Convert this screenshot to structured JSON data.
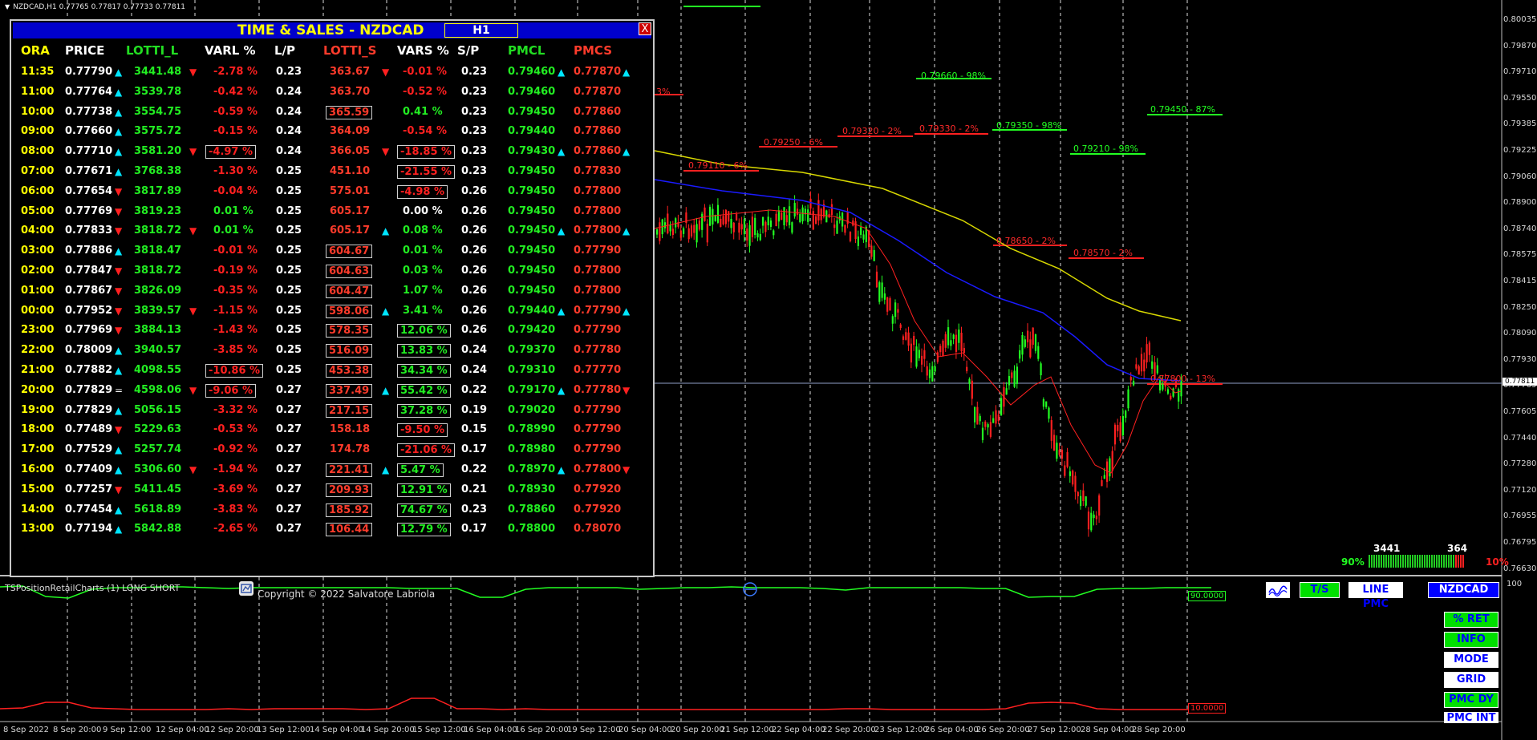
{
  "symbol_header": "NZDCAD,H1  0.77765 0.77817 0.77733 0.77811",
  "ts": {
    "title": "TIME & SALES  - NZDCAD",
    "timeframe": "H1",
    "close_label": "X",
    "headers": [
      "ORA",
      "PRICE",
      "LOTTI_L",
      "VARL %",
      "L/P",
      "LOTTI_S",
      "VARS %",
      "S/P",
      "PMCL",
      "PMCS"
    ],
    "header_colors": [
      "#ffff00",
      "#ffffff",
      "#22dd22",
      "#ffffff",
      "#ffffff",
      "#ff3b2b",
      "#ffffff",
      "#ffffff",
      "#22dd22",
      "#ff3b2b"
    ],
    "rows": [
      {
        "ora": "11:35",
        "price": "0.77790",
        "pdir": "up",
        "lotti_l": "3441.48",
        "ldir": "dn",
        "varl": "-2.78 %",
        "varl_c": "r",
        "varl_box": false,
        "lp": "0.23",
        "lotti_s": "363.67",
        "sdir": "dn",
        "s_box": false,
        "vars": "-0.01 %",
        "vars_c": "r",
        "vars_box": false,
        "sp": "0.23",
        "pmcl": "0.79460",
        "pldir": "up",
        "pmcs": "0.77870",
        "psdir": "up"
      },
      {
        "ora": "11:00",
        "price": "0.77764",
        "pdir": "up",
        "lotti_l": "3539.78",
        "ldir": "",
        "varl": "-0.42 %",
        "varl_c": "r",
        "varl_box": false,
        "lp": "0.24",
        "lotti_s": "363.70",
        "sdir": "",
        "s_box": false,
        "vars": "-0.52 %",
        "vars_c": "r",
        "vars_box": false,
        "sp": "0.23",
        "pmcl": "0.79460",
        "pldir": "",
        "pmcs": "0.77870",
        "psdir": ""
      },
      {
        "ora": "10:00",
        "price": "0.77738",
        "pdir": "up",
        "lotti_l": "3554.75",
        "ldir": "",
        "varl": "-0.59 %",
        "varl_c": "r",
        "varl_box": false,
        "lp": "0.24",
        "lotti_s": "365.59",
        "sdir": "",
        "s_box": true,
        "vars": "0.41 %",
        "vars_c": "g",
        "vars_box": false,
        "sp": "0.23",
        "pmcl": "0.79450",
        "pldir": "",
        "pmcs": "0.77860",
        "psdir": ""
      },
      {
        "ora": "09:00",
        "price": "0.77660",
        "pdir": "up",
        "lotti_l": "3575.72",
        "ldir": "",
        "varl": "-0.15 %",
        "varl_c": "r",
        "varl_box": false,
        "lp": "0.24",
        "lotti_s": "364.09",
        "sdir": "",
        "s_box": false,
        "vars": "-0.54 %",
        "vars_c": "r",
        "vars_box": false,
        "sp": "0.23",
        "pmcl": "0.79440",
        "pldir": "",
        "pmcs": "0.77860",
        "psdir": ""
      },
      {
        "ora": "08:00",
        "price": "0.77710",
        "pdir": "up",
        "lotti_l": "3581.20",
        "ldir": "dn",
        "varl": "-4.97 %",
        "varl_c": "r",
        "varl_box": true,
        "lp": "0.24",
        "lotti_s": "366.05",
        "sdir": "dn",
        "s_box": false,
        "vars": "-18.85 %",
        "vars_c": "r",
        "vars_box": true,
        "sp": "0.23",
        "pmcl": "0.79430",
        "pldir": "up",
        "pmcs": "0.77860",
        "psdir": "up"
      },
      {
        "ora": "07:00",
        "price": "0.77671",
        "pdir": "up",
        "lotti_l": "3768.38",
        "ldir": "",
        "varl": "-1.30 %",
        "varl_c": "r",
        "varl_box": false,
        "lp": "0.25",
        "lotti_s": "451.10",
        "sdir": "",
        "s_box": false,
        "vars": "-21.55 %",
        "vars_c": "r",
        "vars_box": true,
        "sp": "0.23",
        "pmcl": "0.79450",
        "pldir": "",
        "pmcs": "0.77830",
        "psdir": ""
      },
      {
        "ora": "06:00",
        "price": "0.77654",
        "pdir": "dn",
        "lotti_l": "3817.89",
        "ldir": "",
        "varl": "-0.04 %",
        "varl_c": "r",
        "varl_box": false,
        "lp": "0.25",
        "lotti_s": "575.01",
        "sdir": "",
        "s_box": false,
        "vars": "-4.98 %",
        "vars_c": "r",
        "vars_box": true,
        "sp": "0.26",
        "pmcl": "0.79450",
        "pldir": "",
        "pmcs": "0.77800",
        "psdir": ""
      },
      {
        "ora": "05:00",
        "price": "0.77769",
        "pdir": "dn",
        "lotti_l": "3819.23",
        "ldir": "",
        "varl": "0.01 %",
        "varl_c": "g",
        "varl_box": false,
        "lp": "0.25",
        "lotti_s": "605.17",
        "sdir": "",
        "s_box": false,
        "vars": "0.00 %",
        "vars_c": "w",
        "vars_box": false,
        "sp": "0.26",
        "pmcl": "0.79450",
        "pldir": "",
        "pmcs": "0.77800",
        "psdir": ""
      },
      {
        "ora": "04:00",
        "price": "0.77833",
        "pdir": "dn",
        "lotti_l": "3818.72",
        "ldir": "dn",
        "varl": "0.01 %",
        "varl_c": "g",
        "varl_box": false,
        "lp": "0.25",
        "lotti_s": "605.17",
        "sdir": "up",
        "s_box": false,
        "vars": "0.08 %",
        "vars_c": "g",
        "vars_box": false,
        "sp": "0.26",
        "pmcl": "0.79450",
        "pldir": "up",
        "pmcs": "0.77800",
        "psdir": "up"
      },
      {
        "ora": "03:00",
        "price": "0.77886",
        "pdir": "up",
        "lotti_l": "3818.47",
        "ldir": "",
        "varl": "-0.01 %",
        "varl_c": "r",
        "varl_box": false,
        "lp": "0.25",
        "lotti_s": "604.67",
        "sdir": "",
        "s_box": true,
        "vars": "0.01 %",
        "vars_c": "g",
        "vars_box": false,
        "sp": "0.26",
        "pmcl": "0.79450",
        "pldir": "",
        "pmcs": "0.77790",
        "psdir": ""
      },
      {
        "ora": "02:00",
        "price": "0.77847",
        "pdir": "dn",
        "lotti_l": "3818.72",
        "ldir": "",
        "varl": "-0.19 %",
        "varl_c": "r",
        "varl_box": false,
        "lp": "0.25",
        "lotti_s": "604.63",
        "sdir": "",
        "s_box": true,
        "vars": "0.03 %",
        "vars_c": "g",
        "vars_box": false,
        "sp": "0.26",
        "pmcl": "0.79450",
        "pldir": "",
        "pmcs": "0.77800",
        "psdir": ""
      },
      {
        "ora": "01:00",
        "price": "0.77867",
        "pdir": "dn",
        "lotti_l": "3826.09",
        "ldir": "",
        "varl": "-0.35 %",
        "varl_c": "r",
        "varl_box": false,
        "lp": "0.25",
        "lotti_s": "604.47",
        "sdir": "",
        "s_box": true,
        "vars": "1.07 %",
        "vars_c": "g",
        "vars_box": false,
        "sp": "0.26",
        "pmcl": "0.79450",
        "pldir": "",
        "pmcs": "0.77800",
        "psdir": ""
      },
      {
        "ora": "00:00",
        "price": "0.77952",
        "pdir": "dn",
        "lotti_l": "3839.57",
        "ldir": "dn",
        "varl": "-1.15 %",
        "varl_c": "r",
        "varl_box": false,
        "lp": "0.25",
        "lotti_s": "598.06",
        "sdir": "up",
        "s_box": true,
        "vars": "3.41 %",
        "vars_c": "g",
        "vars_box": false,
        "sp": "0.26",
        "pmcl": "0.79440",
        "pldir": "up",
        "pmcs": "0.77790",
        "psdir": "up"
      },
      {
        "ora": "23:00",
        "price": "0.77969",
        "pdir": "dn",
        "lotti_l": "3884.13",
        "ldir": "",
        "varl": "-1.43 %",
        "varl_c": "r",
        "varl_box": false,
        "lp": "0.25",
        "lotti_s": "578.35",
        "sdir": "",
        "s_box": true,
        "vars": "12.06 %",
        "vars_c": "g",
        "vars_box": true,
        "sp": "0.26",
        "pmcl": "0.79420",
        "pldir": "",
        "pmcs": "0.77790",
        "psdir": ""
      },
      {
        "ora": "22:00",
        "price": "0.78009",
        "pdir": "up",
        "lotti_l": "3940.57",
        "ldir": "",
        "varl": "-3.85 %",
        "varl_c": "r",
        "varl_box": false,
        "lp": "0.25",
        "lotti_s": "516.09",
        "sdir": "",
        "s_box": true,
        "vars": "13.83 %",
        "vars_c": "g",
        "vars_box": true,
        "sp": "0.24",
        "pmcl": "0.79370",
        "pldir": "",
        "pmcs": "0.77780",
        "psdir": ""
      },
      {
        "ora": "21:00",
        "price": "0.77882",
        "pdir": "up",
        "lotti_l": "4098.55",
        "ldir": "",
        "varl": "-10.86 %",
        "varl_c": "r",
        "varl_box": true,
        "lp": "0.25",
        "lotti_s": "453.38",
        "sdir": "",
        "s_box": true,
        "vars": "34.34 %",
        "vars_c": "g",
        "vars_box": true,
        "sp": "0.24",
        "pmcl": "0.79310",
        "pldir": "",
        "pmcs": "0.77770",
        "psdir": ""
      },
      {
        "ora": "20:00",
        "price": "0.77829",
        "pdir": "eq",
        "lotti_l": "4598.06",
        "ldir": "dn",
        "varl": "-9.06 %",
        "varl_c": "r",
        "varl_box": true,
        "lp": "0.27",
        "lotti_s": "337.49",
        "sdir": "up",
        "s_box": true,
        "vars": "55.42 %",
        "vars_c": "g",
        "vars_box": true,
        "sp": "0.22",
        "pmcl": "0.79170",
        "pldir": "up",
        "pmcs": "0.77780",
        "psdir": "dn"
      },
      {
        "ora": "19:00",
        "price": "0.77829",
        "pdir": "up",
        "lotti_l": "5056.15",
        "ldir": "",
        "varl": "-3.32 %",
        "varl_c": "r",
        "varl_box": false,
        "lp": "0.27",
        "lotti_s": "217.15",
        "sdir": "",
        "s_box": true,
        "vars": "37.28 %",
        "vars_c": "g",
        "vars_box": true,
        "sp": "0.19",
        "pmcl": "0.79020",
        "pldir": "",
        "pmcs": "0.77790",
        "psdir": ""
      },
      {
        "ora": "18:00",
        "price": "0.77489",
        "pdir": "dn",
        "lotti_l": "5229.63",
        "ldir": "",
        "varl": "-0.53 %",
        "varl_c": "r",
        "varl_box": false,
        "lp": "0.27",
        "lotti_s": "158.18",
        "sdir": "",
        "s_box": false,
        "vars": "-9.50 %",
        "vars_c": "r",
        "vars_box": true,
        "sp": "0.15",
        "pmcl": "0.78990",
        "pldir": "",
        "pmcs": "0.77790",
        "psdir": ""
      },
      {
        "ora": "17:00",
        "price": "0.77529",
        "pdir": "up",
        "lotti_l": "5257.74",
        "ldir": "",
        "varl": "-0.92 %",
        "varl_c": "r",
        "varl_box": false,
        "lp": "0.27",
        "lotti_s": "174.78",
        "sdir": "",
        "s_box": false,
        "vars": "-21.06 %",
        "vars_c": "r",
        "vars_box": true,
        "sp": "0.17",
        "pmcl": "0.78980",
        "pldir": "",
        "pmcs": "0.77790",
        "psdir": ""
      },
      {
        "ora": "16:00",
        "price": "0.77409",
        "pdir": "up",
        "lotti_l": "5306.60",
        "ldir": "dn",
        "varl": "-1.94 %",
        "varl_c": "r",
        "varl_box": false,
        "lp": "0.27",
        "lotti_s": "221.41",
        "sdir": "up",
        "s_box": true,
        "vars": "5.47 %",
        "vars_c": "g",
        "vars_box": true,
        "sp": "0.22",
        "pmcl": "0.78970",
        "pldir": "up",
        "pmcs": "0.77800",
        "psdir": "dn"
      },
      {
        "ora": "15:00",
        "price": "0.77257",
        "pdir": "dn",
        "lotti_l": "5411.45",
        "ldir": "",
        "varl": "-3.69 %",
        "varl_c": "r",
        "varl_box": false,
        "lp": "0.27",
        "lotti_s": "209.93",
        "sdir": "",
        "s_box": true,
        "vars": "12.91 %",
        "vars_c": "g",
        "vars_box": true,
        "sp": "0.21",
        "pmcl": "0.78930",
        "pldir": "",
        "pmcs": "0.77920",
        "psdir": ""
      },
      {
        "ora": "14:00",
        "price": "0.77454",
        "pdir": "up",
        "lotti_l": "5618.89",
        "ldir": "",
        "varl": "-3.83 %",
        "varl_c": "r",
        "varl_box": false,
        "lp": "0.27",
        "lotti_s": "185.92",
        "sdir": "",
        "s_box": true,
        "vars": "74.67 %",
        "vars_c": "g",
        "vars_box": true,
        "sp": "0.23",
        "pmcl": "0.78860",
        "pldir": "",
        "pmcs": "0.77920",
        "psdir": ""
      },
      {
        "ora": "13:00",
        "price": "0.77194",
        "pdir": "up",
        "lotti_l": "5842.88",
        "ldir": "",
        "varl": "-2.65 %",
        "varl_c": "r",
        "varl_box": false,
        "lp": "0.27",
        "lotti_s": "106.44",
        "sdir": "",
        "s_box": true,
        "vars": "12.79 %",
        "vars_c": "g",
        "vars_box": true,
        "sp": "0.17",
        "pmcl": "0.78800",
        "pldir": "",
        "pmcs": "0.78070",
        "psdir": ""
      }
    ]
  },
  "price_axis": [
    "0.80035",
    "0.79870",
    "0.79710",
    "0.79550",
    "0.79385",
    "0.79225",
    "0.79060",
    "0.78900",
    "0.78740",
    "0.78575",
    "0.78415",
    "0.78250",
    "0.78090",
    "0.77930",
    "0.77765",
    "0.77605",
    "0.77440",
    "0.77280",
    "0.77120",
    "0.76955",
    "0.76795",
    "0.76630"
  ],
  "current_price": "0.77811",
  "indicator_max": "100",
  "time_axis": [
    "8 Sep 2022",
    "8 Sep 20:00",
    "9 Sep 12:00",
    "12 Sep 04:00",
    "12 Sep 20:00",
    "13 Sep 12:00",
    "14 Sep 04:00",
    "14 Sep 20:00",
    "15 Sep 12:00",
    "16 Sep 04:00",
    "16 Sep 20:00",
    "19 Sep 12:00",
    "20 Sep 04:00",
    "20 Sep 20:00",
    "21 Sep 12:00",
    "22 Sep 04:00",
    "22 Sep 20:00",
    "23 Sep 12:00",
    "26 Sep 04:00",
    "26 Sep 20:00",
    "27 Sep 12:00",
    "28 Sep 04:00",
    "28 Sep 20:00"
  ],
  "levels": [
    {
      "text": "0.79660 - 98%",
      "color": "green"
    },
    {
      "text": "0.79450 - 87%",
      "color": "green"
    },
    {
      "text": "0.79350 - 98%",
      "color": "green"
    },
    {
      "text": "0.79210 - 98%",
      "color": "green"
    },
    {
      "text": "0.79250 - 6%",
      "color": "red"
    },
    {
      "text": "0.79320 - 2%",
      "color": "red"
    },
    {
      "text": "0.79330 - 2%",
      "color": "red"
    },
    {
      "text": "0.79110 - 6%",
      "color": "red"
    },
    {
      "text": "0.78650 - 2%",
      "color": "red"
    },
    {
      "text": "0.78570 - 2%",
      "color": "red"
    },
    {
      "text": "0.77800 - 13%",
      "color": "red"
    },
    {
      "text": "3%",
      "color": "red"
    }
  ],
  "indicator": {
    "name": "TSPositionRetailCharts (1) LONG SHORT",
    "copyright": "Copyright © 2022 Salvatore Labriola",
    "top_value": "90.0000",
    "bottom_value": "10.0000"
  },
  "longshort": {
    "long_lots": "3441",
    "short_lots": "364",
    "long_pct": "90%",
    "short_pct": "10%",
    "long_fraction": 0.9
  },
  "buttons": {
    "ts": "T/S",
    "line_pmc": "LINE PMC",
    "symbol": "NZDCAD",
    "ret": "% RET",
    "info": "INFO",
    "mode": "MODE",
    "grid": "GRID",
    "pmc_dy": "PMC DY",
    "pmc_int": "PMC INT"
  },
  "colors": {
    "bull": "#22ff22",
    "bear": "#ff2020",
    "ma_yellow": "#d8d800",
    "ma_blue": "#1a1aff",
    "ma_red": "#ff2020",
    "panel_title_bg": "#0000cc"
  }
}
